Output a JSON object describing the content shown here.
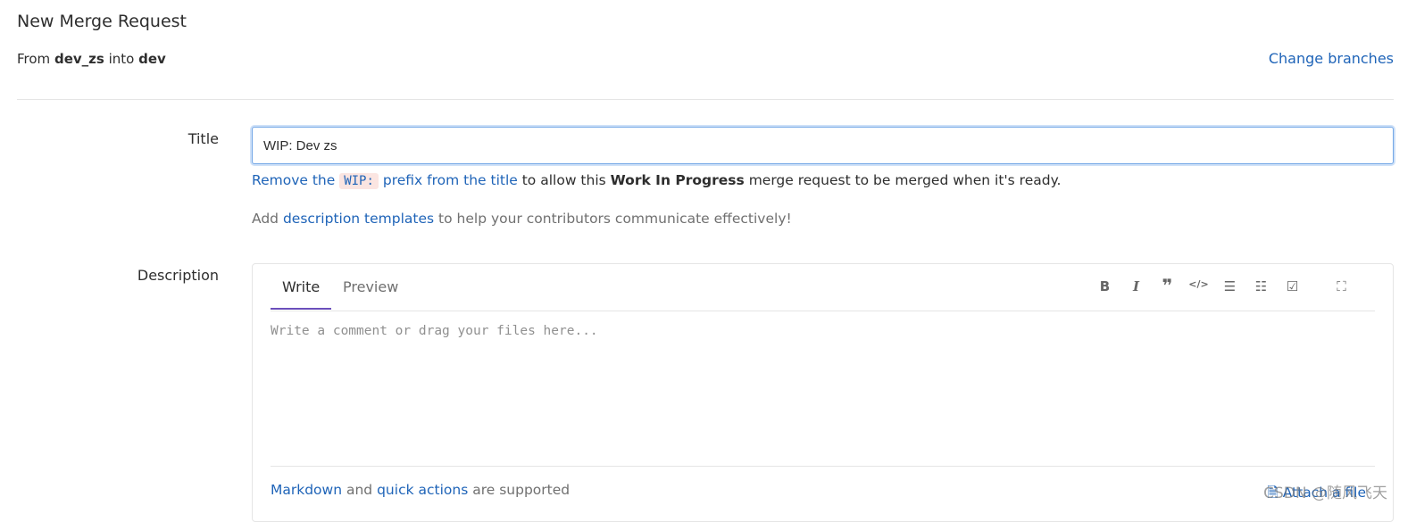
{
  "header": {
    "title": "New Merge Request",
    "from_prefix": "From",
    "source_branch": "dev_zs",
    "into": "into",
    "target_branch": "dev",
    "change_branches": "Change branches"
  },
  "form": {
    "title_label": "Title",
    "title_value": "WIP: Dev zs",
    "wip_hint": {
      "link1": "Remove the",
      "code": "WIP:",
      "link2": "prefix from the title",
      "text1": "to allow this",
      "bold": "Work In Progress",
      "text2": "merge request to be merged when it's ready."
    },
    "templates_hint": {
      "text1": "Add",
      "link": "description templates",
      "text2": "to help your contributors communicate effectively!"
    },
    "description_label": "Description",
    "editor": {
      "tabs": [
        "Write",
        "Preview"
      ],
      "toolbar": [
        "bold-icon",
        "italic-icon",
        "quote-icon",
        "code-icon",
        "bullet-list-icon",
        "numbered-list-icon",
        "task-list-icon",
        "fullscreen-icon"
      ],
      "placeholder": "Write a comment or drag your files here...",
      "footer": {
        "markdown": "Markdown",
        "and": "and",
        "quick_actions": "quick actions",
        "supported": "are supported",
        "attach": "Attach a file"
      }
    }
  },
  "watermark": "CSDN @随风飞天",
  "colors": {
    "link": "#1f64b8",
    "active_tab": "#6b4fbb",
    "focus_border": "#73a7e6"
  }
}
